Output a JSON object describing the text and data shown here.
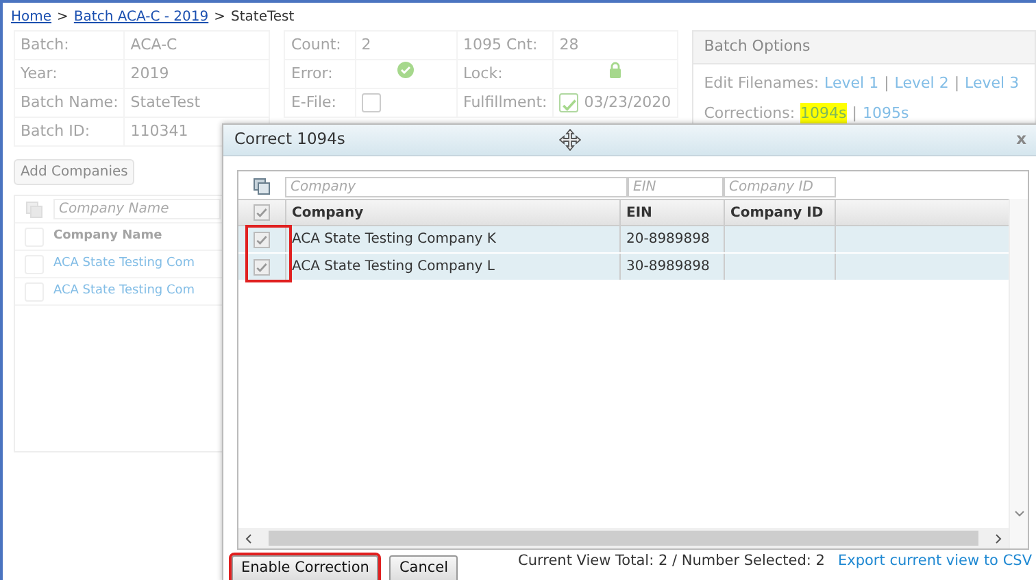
{
  "breadcrumb": [
    {
      "label": "Home",
      "kind": "link"
    },
    {
      "label": ">",
      "kind": "sep"
    },
    {
      "label": "Batch ACA-C - 2019",
      "kind": "link"
    },
    {
      "label": ">",
      "kind": "sep"
    },
    {
      "label": "StateTest",
      "kind": "current"
    }
  ],
  "batch_info": [
    {
      "label": "Batch:",
      "value": "ACA-C"
    },
    {
      "label": "Year:",
      "value": "2019"
    },
    {
      "label": "Batch Name:",
      "value": "StateTest"
    },
    {
      "label": "Batch ID:",
      "value": "110341"
    }
  ],
  "status_info": [
    {
      "label": "Count:",
      "kind": "text",
      "value": "2"
    },
    {
      "label": "1095 Cnt:",
      "kind": "text",
      "value": "28"
    },
    {
      "label": "Error:",
      "kind": "ok"
    },
    {
      "label": "Lock:",
      "kind": "lock"
    },
    {
      "label": "E-File:",
      "kind": "checkbox",
      "checked": false
    },
    {
      "label": "Fulfillment:",
      "kind": "checkbox",
      "checked": true,
      "value": "03/23/2020"
    }
  ],
  "batch_options": {
    "title": "Batch Options",
    "lines": [
      {
        "label": "Edit Filenames:",
        "links": [
          {
            "label": "Level 1",
            "kind": "link",
            "highlighted": false
          },
          {
            "label": "|",
            "kind": "sep"
          },
          {
            "label": "Level 2",
            "kind": "link",
            "highlighted": false
          },
          {
            "label": "|",
            "kind": "sep"
          },
          {
            "label": "Level 3",
            "kind": "link",
            "highlighted": false
          }
        ]
      },
      {
        "label": "Corrections:",
        "links": [
          {
            "label": "1094s",
            "kind": "link",
            "highlighted": true
          },
          {
            "label": "|",
            "kind": "sep"
          },
          {
            "label": "1095s",
            "kind": "link",
            "highlighted": false
          }
        ]
      }
    ]
  },
  "add_button": {
    "label": "Add Companies",
    "disabled": true
  },
  "companies_grid": {
    "filter_placeholder": "Company Name",
    "column": "Company Name",
    "header_checked": false,
    "rows": [
      {
        "company": "ACA State Testing Com",
        "checked": false
      },
      {
        "company": "ACA State Testing Com",
        "checked": false
      }
    ]
  },
  "dialog": {
    "title": "Correct 1094s",
    "close": "x",
    "filters": [
      {
        "placeholder": "Company"
      },
      {
        "placeholder": "EIN"
      },
      {
        "placeholder": "Company ID"
      }
    ],
    "columns": [
      "Company",
      "EIN",
      "Company ID"
    ],
    "header_checked": true,
    "rows_outlined": true,
    "rows": [
      {
        "company": "ACA State Testing Company K",
        "ein": "20-8989898",
        "checked": true
      },
      {
        "company": "ACA State Testing Company L",
        "ein": "30-8989898",
        "checked": true
      }
    ],
    "buttons": [
      {
        "label": "Enable Correction",
        "outlined": true
      },
      {
        "label": "Cancel",
        "outlined": false
      }
    ],
    "status": "Current View Total: 2 / Number Selected: 2",
    "export_link": "Export current view to CSV"
  }
}
